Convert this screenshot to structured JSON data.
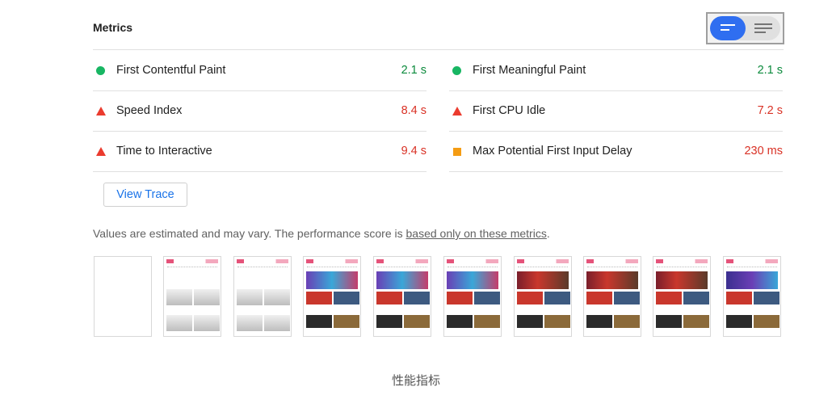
{
  "header": {
    "title": "Metrics"
  },
  "toggle": {
    "left_icon": "lines-icon",
    "right_icon": "lines-icon",
    "accent": "#2f6ef0"
  },
  "metrics": [
    {
      "label": "First Contentful Paint",
      "value": "2.1 s",
      "status": "pass",
      "icon": "circle"
    },
    {
      "label": "First Meaningful Paint",
      "value": "2.1 s",
      "status": "pass",
      "icon": "circle"
    },
    {
      "label": "Speed Index",
      "value": "8.4 s",
      "status": "fail",
      "icon": "triangle"
    },
    {
      "label": "First CPU Idle",
      "value": "7.2 s",
      "status": "fail",
      "icon": "triangle"
    },
    {
      "label": "Time to Interactive",
      "value": "9.4 s",
      "status": "fail",
      "icon": "triangle"
    },
    {
      "label": "Max Potential First Input Delay",
      "value": "230 ms",
      "status": "average",
      "icon": "square"
    }
  ],
  "actions": {
    "view_trace": "View Trace"
  },
  "note": {
    "text": "Values are estimated and may vary. The performance score is ",
    "link": "based only on these metrics",
    "suffix": "."
  },
  "filmstrip": {
    "frame_count": 10
  },
  "caption": "性能指标",
  "colors": {
    "pass": "#0b8a3c",
    "fail": "#d93125",
    "average": "#f49c14",
    "link": "#1a73e8"
  }
}
